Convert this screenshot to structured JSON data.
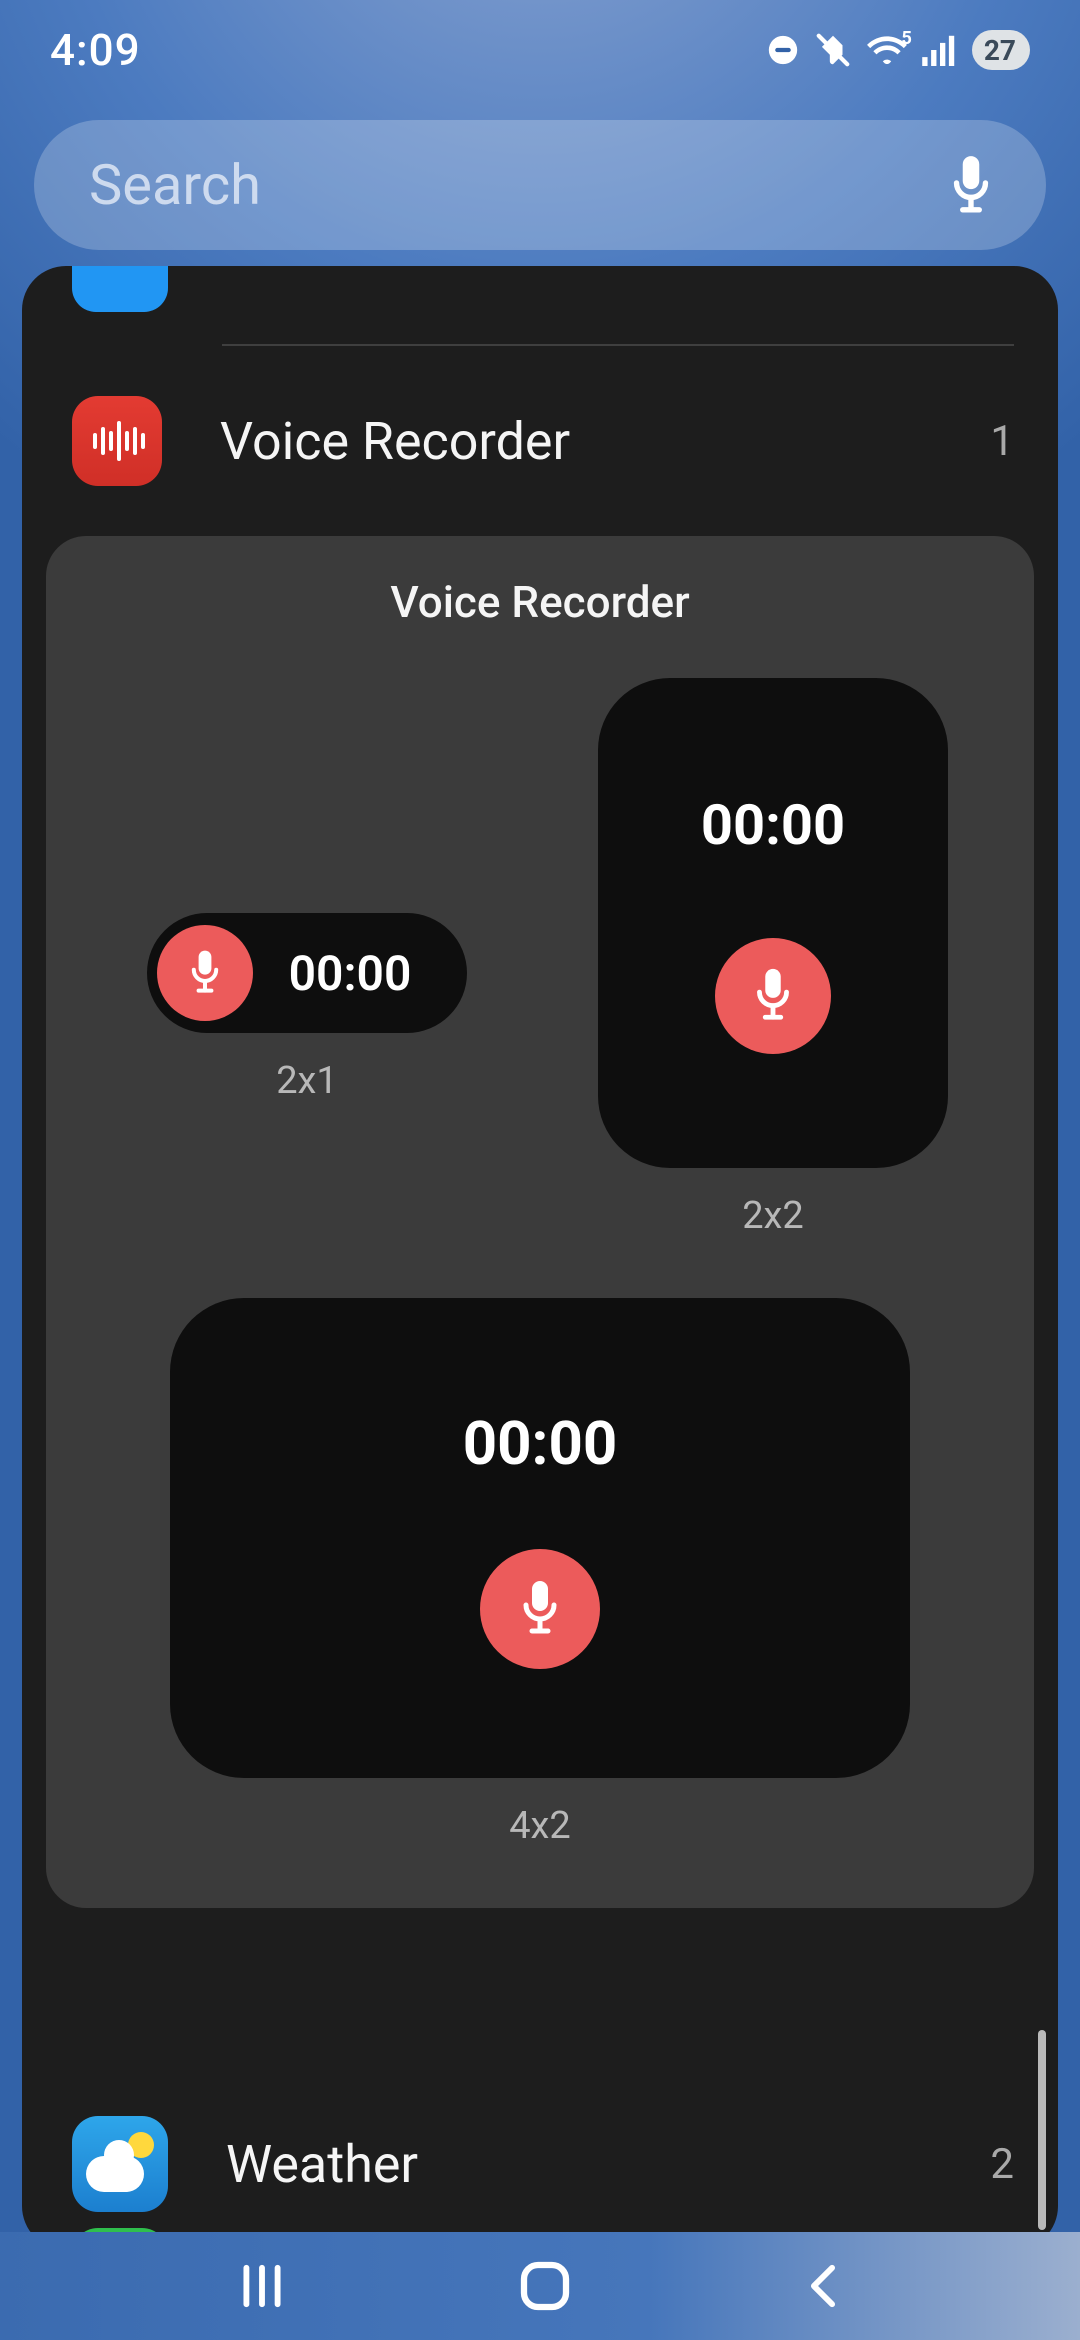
{
  "status": {
    "time": "4:09",
    "battery_pct": "27"
  },
  "search": {
    "placeholder": "Search"
  },
  "apps": {
    "voice_recorder": {
      "name": "Voice Recorder",
      "count": "1"
    },
    "weather": {
      "name": "Weather",
      "count": "2"
    }
  },
  "widget_card": {
    "title": "Voice Recorder",
    "w2x1": {
      "time": "00:00",
      "size": "2x1"
    },
    "w2x2": {
      "time": "00:00",
      "size": "2x2"
    },
    "w4x2": {
      "time": "00:00",
      "size": "4x2"
    }
  }
}
